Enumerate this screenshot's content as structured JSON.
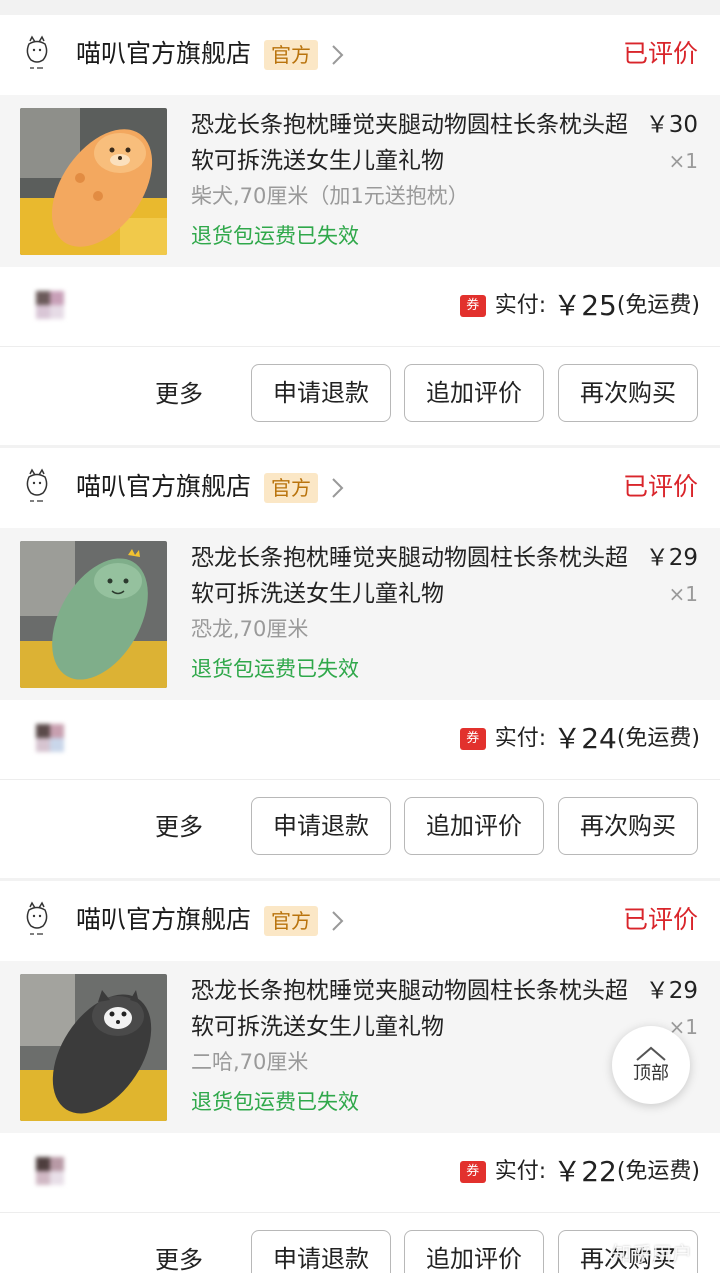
{
  "orders": [
    {
      "shop_name": "喵叭官方旗舰店",
      "official_badge": "官方",
      "status": "已评价",
      "item": {
        "title": "恐龙长条抱枕睡觉夹腿动物圆柱长条枕头超软可拆洗送女生儿童礼物",
        "spec": "柴犬,70厘米（加1元送抱枕）",
        "return_note": "退货包运费已失效",
        "price": "￥30",
        "qty": "×1",
        "thumb_icon": "shiba-plush-pillow-photo"
      },
      "coupon_label": "券",
      "pay_label": "实付:",
      "pay_amount": "￥25",
      "shipping_note": "(免运费)",
      "more_label": "更多",
      "buttons": [
        "申请退款",
        "追加评价",
        "再次购买"
      ]
    },
    {
      "shop_name": "喵叭官方旗舰店",
      "official_badge": "官方",
      "status": "已评价",
      "item": {
        "title": "恐龙长条抱枕睡觉夹腿动物圆柱长条枕头超软可拆洗送女生儿童礼物",
        "spec": "恐龙,70厘米",
        "return_note": "退货包运费已失效",
        "price": "￥29",
        "qty": "×1",
        "thumb_icon": "dinosaur-plush-pillow-photo"
      },
      "coupon_label": "券",
      "pay_label": "实付:",
      "pay_amount": "￥24",
      "shipping_note": "(免运费)",
      "more_label": "更多",
      "buttons": [
        "申请退款",
        "追加评价",
        "再次购买"
      ]
    },
    {
      "shop_name": "喵叭官方旗舰店",
      "official_badge": "官方",
      "status": "已评价",
      "item": {
        "title": "恐龙长条抱枕睡觉夹腿动物圆柱长条枕头超软可拆洗送女生儿童礼物",
        "spec": "二哈,70厘米",
        "return_note": "退货包运费已失效",
        "price": "￥29",
        "qty": "×1",
        "thumb_icon": "husky-plush-pillow-photo"
      },
      "coupon_label": "券",
      "pay_label": "实付:",
      "pay_amount": "￥22",
      "shipping_note": "(免运费)",
      "more_label": "更多",
      "buttons": [
        "申请退款",
        "追加评价",
        "再次购买"
      ]
    }
  ],
  "back_to_top": {
    "label": "顶部",
    "icon": "chevron-up-icon"
  },
  "watermark": "知乎用户",
  "colors": {
    "status_red": "#d9252b",
    "badge_bg": "#fbe7c6",
    "badge_text": "#b9730c",
    "return_green": "#2fa84a",
    "coupon_red": "#e2312d"
  }
}
